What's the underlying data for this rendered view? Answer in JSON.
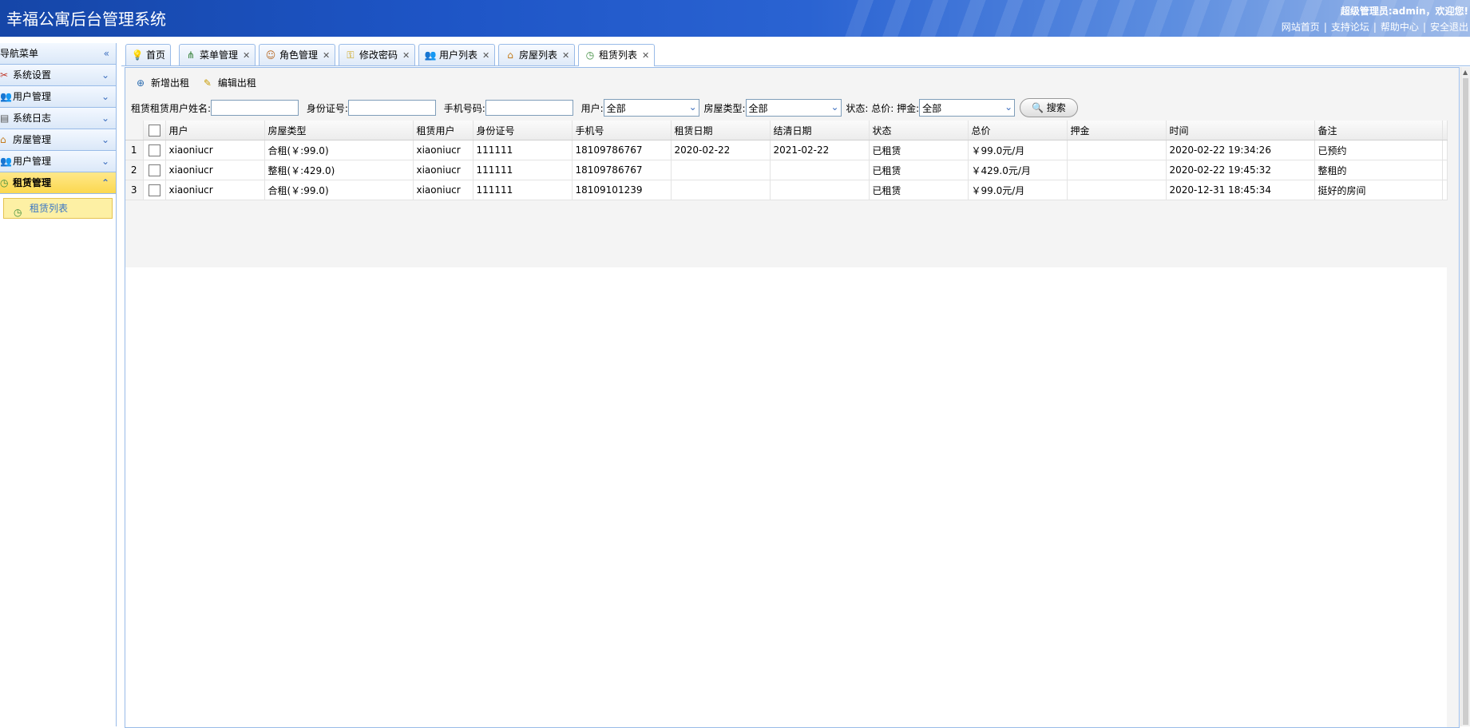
{
  "header": {
    "title": "幸福公寓后台管理系统",
    "welcome": "超级管理员:admin，欢迎您!",
    "links": [
      "网站首页",
      "支持论坛",
      "帮助中心",
      "安全退出"
    ]
  },
  "sidebar": {
    "title": "导航菜单",
    "items": [
      {
        "label": "系统设置",
        "icon": "tools-icon"
      },
      {
        "label": "用户管理",
        "icon": "users-icon"
      },
      {
        "label": "系统日志",
        "icon": "log-icon"
      },
      {
        "label": "房屋管理",
        "icon": "house-icon"
      },
      {
        "label": "用户管理",
        "icon": "users-icon"
      },
      {
        "label": "租赁管理",
        "icon": "clock-icon"
      }
    ],
    "sub_item": {
      "label": "租赁列表",
      "icon": "clock-icon"
    }
  },
  "tabs": [
    {
      "label": "首页",
      "icon": "bulb-icon",
      "closable": false
    },
    {
      "label": "菜单管理",
      "icon": "tree-icon",
      "closable": true
    },
    {
      "label": "角色管理",
      "icon": "role-icon",
      "closable": true
    },
    {
      "label": "修改密码",
      "icon": "key-icon",
      "closable": true
    },
    {
      "label": "用户列表",
      "icon": "users-icon",
      "closable": true
    },
    {
      "label": "房屋列表",
      "icon": "house-icon",
      "closable": true
    },
    {
      "label": "租赁列表",
      "icon": "clock-icon",
      "closable": true
    }
  ],
  "toolbar": {
    "add_label": "新增出租",
    "edit_label": "编辑出租"
  },
  "search": {
    "name_label": "租赁租赁用户姓名:",
    "idcard_label": "身份证号:",
    "phone_label": "手机号码:",
    "user_label": "用户:",
    "user_value": "全部",
    "house_type_label": "房屋类型:",
    "house_type_value": "全部",
    "status_label": "状态: 总价: 押金:",
    "deposit_value": "全部",
    "search_button": "搜索"
  },
  "table": {
    "columns": [
      "用户",
      "房屋类型",
      "租赁用户",
      "身份证号",
      "手机号",
      "租赁日期",
      "结清日期",
      "状态",
      "总价",
      "押金",
      "时间",
      "备注"
    ],
    "rows": [
      {
        "num": "1",
        "cells": [
          "xiaoniucr",
          "合租(￥:99.0)",
          "xiaoniucr",
          "111111",
          "18109786767",
          "2020-02-22",
          "2021-02-22",
          "已租赁",
          "￥99.0元/月",
          "",
          "2020-02-22 19:34:26",
          "已预约"
        ]
      },
      {
        "num": "2",
        "cells": [
          "xiaoniucr",
          "整租(￥:429.0)",
          "xiaoniucr",
          "111111",
          "18109786767",
          "",
          "",
          "已租赁",
          "￥429.0元/月",
          "",
          "2020-02-22 19:45:32",
          "整租的"
        ]
      },
      {
        "num": "3",
        "cells": [
          "xiaoniucr",
          "合租(￥:99.0)",
          "xiaoniucr",
          "111111",
          "18109101239",
          "",
          "",
          "已租赁",
          "￥99.0元/月",
          "",
          "2020-12-31 18:45:34",
          "挺好的房间"
        ]
      }
    ]
  }
}
